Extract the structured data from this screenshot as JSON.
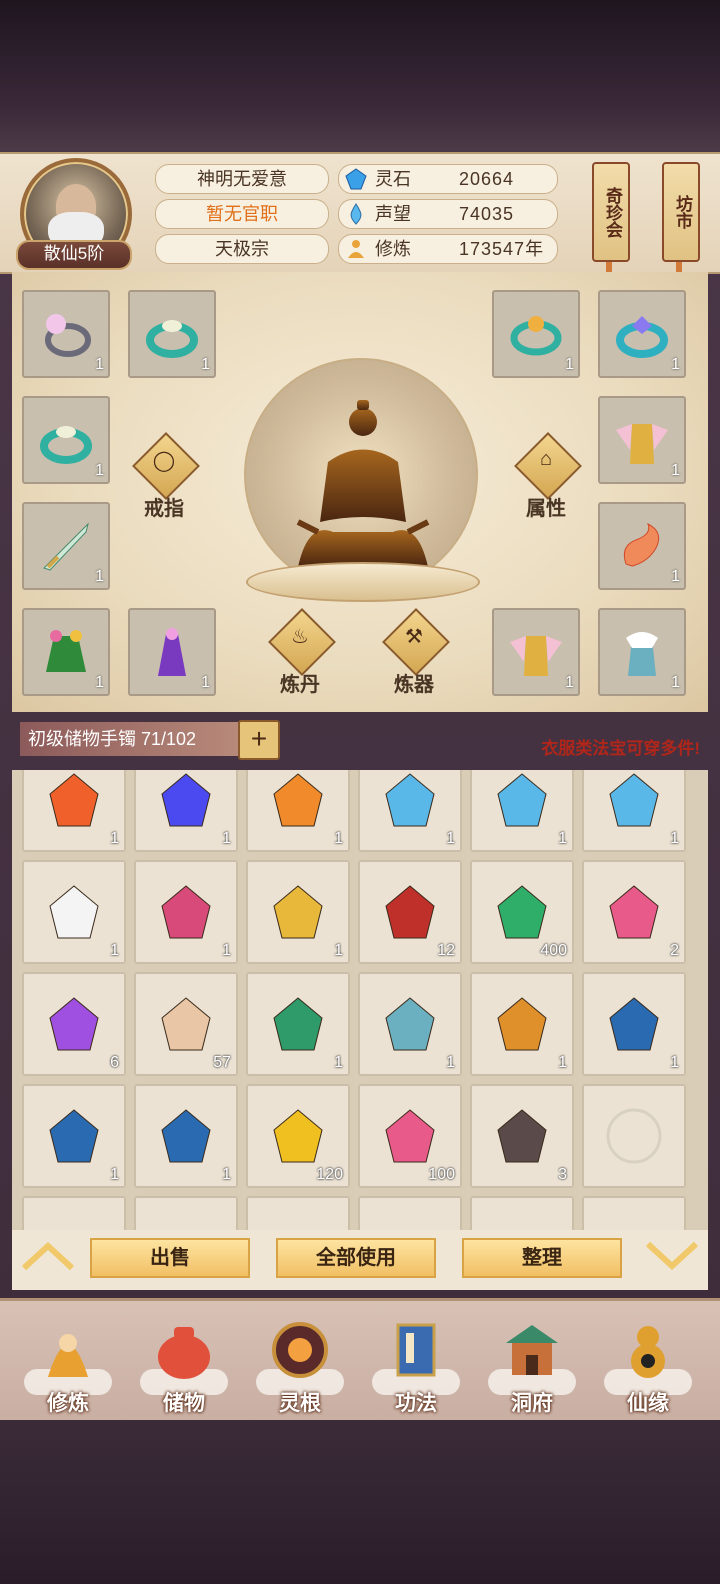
{
  "header": {
    "rank": "散仙5阶",
    "name": "神明无爱意",
    "official_title": "暂无官职",
    "sect": "天极宗",
    "resources": [
      {
        "icon": "spirit-stone-icon",
        "label": "灵石",
        "value": "20664"
      },
      {
        "icon": "prestige-drop-icon",
        "label": "声望",
        "value": "74035"
      },
      {
        "icon": "meditation-icon",
        "label": "修炼",
        "value": "173547年"
      }
    ],
    "side_buttons": [
      "奇珍会",
      "坊市"
    ]
  },
  "equipment": {
    "left_slots": [
      {
        "item": "pearl-ring-icon",
        "count": "1"
      },
      {
        "item": "jade-ring-icon",
        "count": "1"
      },
      {
        "item": "jade-ring-icon",
        "count": "1"
      },
      {
        "item": "sword-icon",
        "count": "1"
      },
      {
        "item": "leaf-robe-icon",
        "count": "1"
      },
      {
        "item": "purple-robe-icon",
        "count": "1"
      }
    ],
    "right_slots": [
      {
        "item": "gold-ring-icon",
        "count": "1"
      },
      {
        "item": "blue-gem-ring-icon",
        "count": "1"
      },
      {
        "item": "winged-armor-icon",
        "count": "1"
      },
      {
        "item": "dragon-icon",
        "count": "1"
      },
      {
        "item": "winged-armor-icon",
        "count": "1"
      },
      {
        "item": "white-fur-robe-icon",
        "count": "1"
      }
    ],
    "labels": {
      "rings": "戒指",
      "attributes": "属性",
      "alchemy": "炼丹",
      "forging": "炼器"
    }
  },
  "storage": {
    "title": "初级储物手镯",
    "capacity": "71/102",
    "plus": "+",
    "tip": "衣服类法宝可穿多件!"
  },
  "inventory": [
    {
      "item": "fire-orbs-icon",
      "count": "1"
    },
    {
      "item": "blue-flame-icon",
      "count": "1"
    },
    {
      "item": "fire-ring-icon",
      "count": "1"
    },
    {
      "item": "water-drop-icon",
      "count": "1"
    },
    {
      "item": "water-drop-icon",
      "count": "1"
    },
    {
      "item": "water-drop-icon",
      "count": "1"
    },
    {
      "item": "white-tree-icon",
      "count": "1"
    },
    {
      "item": "pink-tree-icon",
      "count": "1"
    },
    {
      "item": "gold-tree-icon",
      "count": "1"
    },
    {
      "item": "teapot-icon",
      "count": "12"
    },
    {
      "item": "green-gem-icon",
      "count": "400"
    },
    {
      "item": "scroll-icon",
      "count": "2"
    },
    {
      "item": "purple-crystal-icon",
      "count": "6"
    },
    {
      "item": "paper-scroll-icon",
      "count": "57"
    },
    {
      "item": "green-armor-icon",
      "count": "1"
    },
    {
      "item": "white-fur-robe-icon",
      "count": "1"
    },
    {
      "item": "bow-icon",
      "count": "1"
    },
    {
      "item": "blue-robe-icon",
      "count": "1"
    },
    {
      "item": "blue-robe-icon",
      "count": "1"
    },
    {
      "item": "blue-robe-icon",
      "count": "1"
    },
    {
      "item": "gold-shield-icon",
      "count": "120"
    },
    {
      "item": "scroll-icon",
      "count": "100"
    },
    {
      "item": "dark-ore-icon",
      "count": "3"
    },
    {
      "item": "yin-yang-icon",
      "count": ""
    }
  ],
  "actions": {
    "sell": "出售",
    "use_all": "全部使用",
    "sort": "整理"
  },
  "nav": [
    {
      "icon": "cultivate-icon",
      "label": "修炼"
    },
    {
      "icon": "storage-bag-icon",
      "label": "储物"
    },
    {
      "icon": "spirit-root-icon",
      "label": "灵根"
    },
    {
      "icon": "technique-book-icon",
      "label": "功法"
    },
    {
      "icon": "cave-abode-icon",
      "label": "洞府"
    },
    {
      "icon": "fortune-gourd-icon",
      "label": "仙缘"
    }
  ],
  "colors": {
    "accent": "#f1c064",
    "warning": "#b0261a",
    "orange": "#e0701a"
  }
}
